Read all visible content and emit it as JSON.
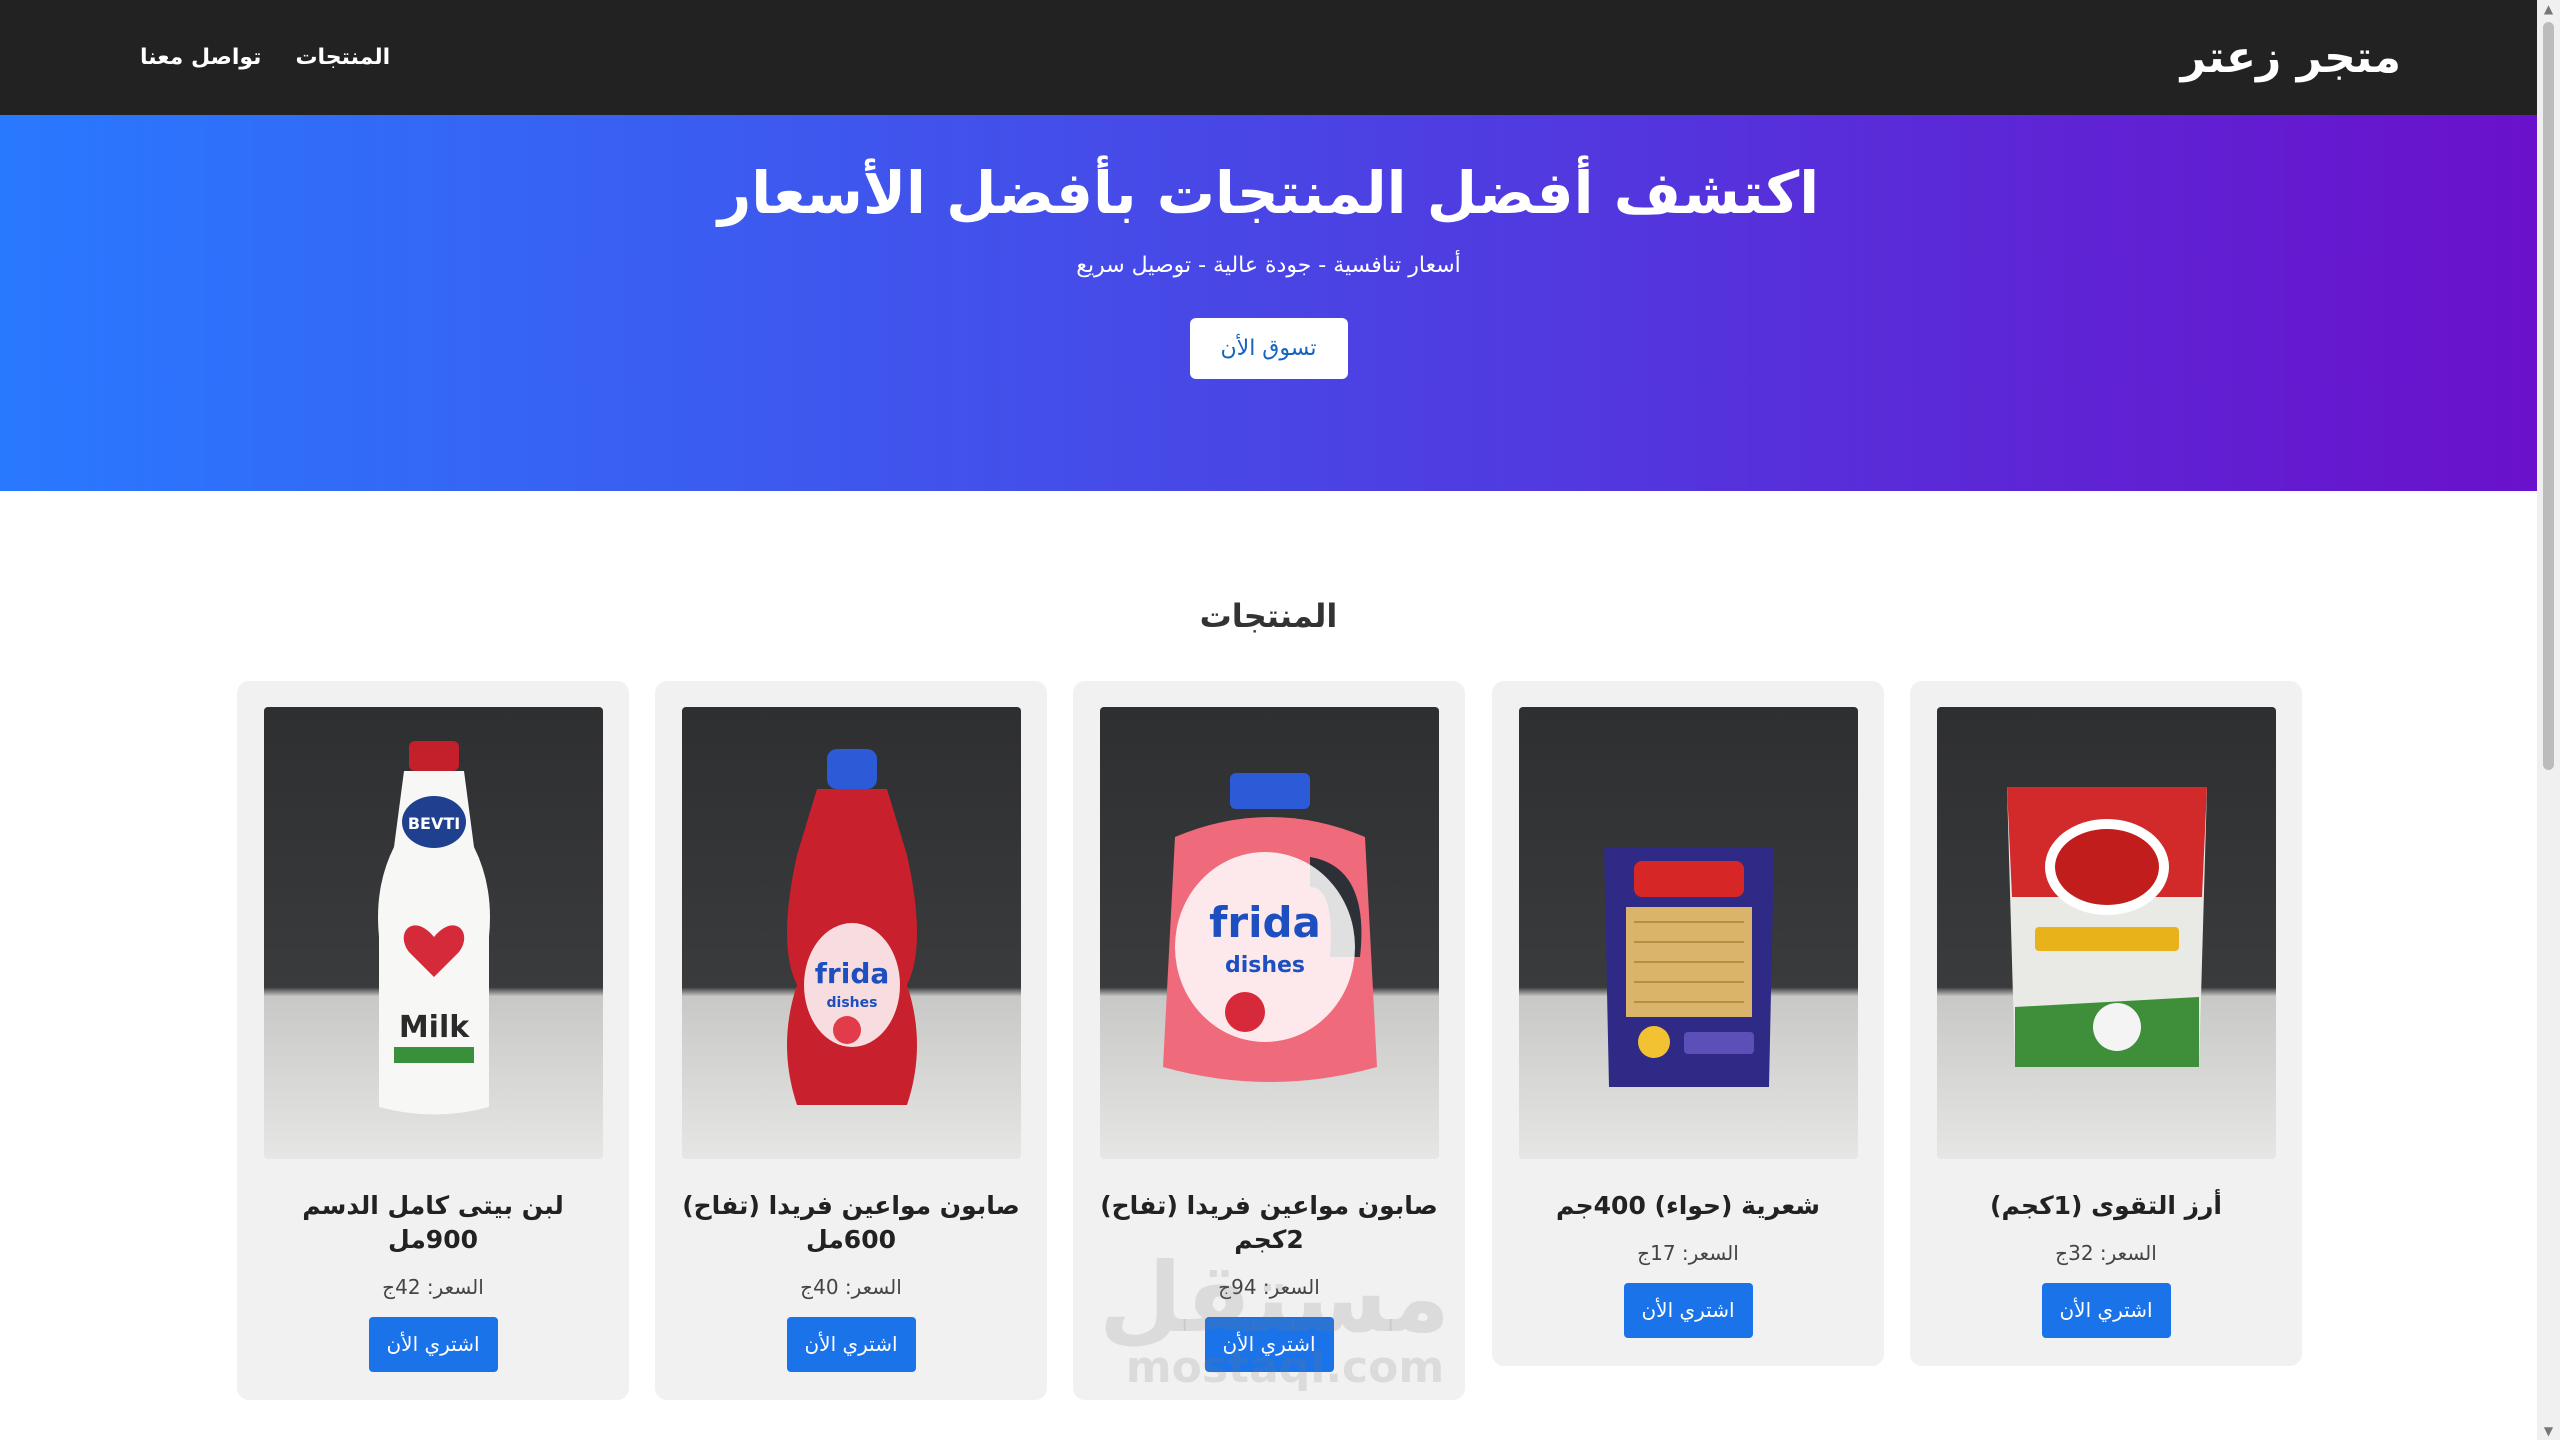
{
  "header": {
    "brand": "متجر زعتر",
    "nav": [
      "المنتجات",
      "تواصل معنا"
    ]
  },
  "hero": {
    "title": "اكتشف أفضل المنتجات بأفضل الأسعار",
    "subtitle": "أسعار تنافسية - جودة عالية - توصيل سريع",
    "cta": "تسوق الأن"
  },
  "products_section": {
    "title": "المنتجات",
    "items": [
      {
        "name": "أرز التقوى (1كجم)",
        "price": "السعر: 32ج",
        "buy": "اشتري الأن",
        "image": "rice-bag"
      },
      {
        "name": "شعرية (حواء) 400جم",
        "price": "السعر: 17ج",
        "buy": "اشتري الأن",
        "image": "vermicelli-pack"
      },
      {
        "name": "صابون مواعين فريدا (تفاح) 2كجم",
        "price": "السعر: 94ج",
        "buy": "اشتري الأن",
        "image": "dish-soap-gallon"
      },
      {
        "name": "صابون مواعين فريدا (تفاح) 600مل",
        "price": "السعر: 40ج",
        "buy": "اشتري الأن",
        "image": "dish-soap-bottle"
      },
      {
        "name": "لبن بيتى كامل الدسم 900مل",
        "price": "السعر: 42ج",
        "buy": "اشتري الأن",
        "image": "milk-bottle"
      }
    ]
  },
  "watermark": {
    "arabic": "مستقل",
    "latin": "mostaql.com"
  },
  "colors": {
    "header_bg": "#222222",
    "hero_start": "#2979ff",
    "hero_end": "#6a11cb",
    "button": "#1a73e8",
    "card_bg": "#f1f1f1"
  }
}
